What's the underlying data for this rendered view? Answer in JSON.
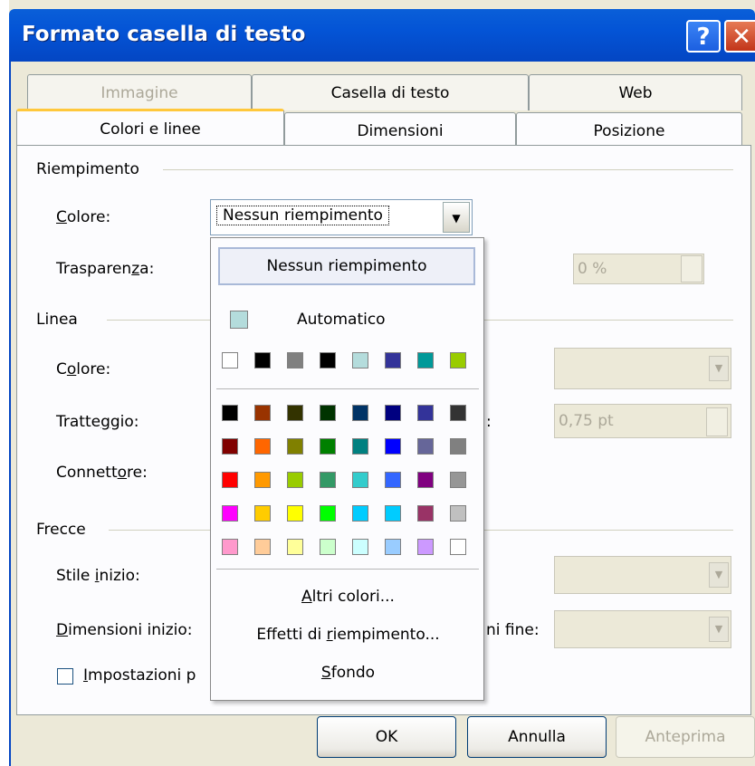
{
  "window": {
    "title": "Formato casella di testo",
    "help_label": "?",
    "close_label": "✕"
  },
  "tabs_back": [
    {
      "label": "Immagine",
      "disabled": true
    },
    {
      "label": "Casella di testo"
    },
    {
      "label": "Web"
    }
  ],
  "tabs_front": [
    {
      "label": "Colori e linee",
      "active": true
    },
    {
      "label": "Dimensioni"
    },
    {
      "label": "Posizione"
    }
  ],
  "fill": {
    "group_label": "Riempimento",
    "color_label": "Colore:",
    "color_value": "Nessun riempimento",
    "transparency_label": "Trasparenza:",
    "transparency_value": "0 %"
  },
  "line": {
    "group_label": "Linea",
    "color_label": "Colore:",
    "dash_label": "Tratteggio:",
    "connector_label": "Connettore:",
    "weight_label_tail": ":",
    "weight_value": "0,75 pt"
  },
  "arrows": {
    "group_label": "Frecce",
    "start_style_label": "Stile inizio:",
    "start_size_label": "Dimensioni inizio:",
    "end_size_label_tail": "ni fine:"
  },
  "defaults_checkbox_label": "Impostazioni p",
  "popup": {
    "no_fill": "Nessun riempimento",
    "automatic": "Automatico",
    "automatic_color": "#b4dcdc",
    "recent_colors": [
      "#ffffff",
      "#000000",
      "#808080",
      "#000000",
      "#b4dcdc",
      "#333399",
      "#009999",
      "#99cc00"
    ],
    "palette": [
      [
        "#000000",
        "#993300",
        "#333300",
        "#003300",
        "#003366",
        "#000080",
        "#333399",
        "#333333"
      ],
      [
        "#800000",
        "#ff6600",
        "#808000",
        "#008000",
        "#008080",
        "#0000ff",
        "#666699",
        "#808080"
      ],
      [
        "#ff0000",
        "#ff9900",
        "#99cc00",
        "#339966",
        "#33cccc",
        "#3366ff",
        "#800080",
        "#969696"
      ],
      [
        "#ff00ff",
        "#ffcc00",
        "#ffff00",
        "#00ff00",
        "#00ccff",
        "#00ccff",
        "#993366",
        "#c0c0c0"
      ],
      [
        "#ff99cc",
        "#ffcc99",
        "#ffff99",
        "#ccffcc",
        "#ccffff",
        "#99ccff",
        "#cc99ff",
        "#ffffff"
      ]
    ],
    "more_colors": "Altri colori...",
    "fill_effects": "Effetti di riempimento...",
    "background": "Sfondo"
  },
  "buttons": {
    "ok": "OK",
    "cancel": "Annulla",
    "preview": "Anteprima"
  }
}
